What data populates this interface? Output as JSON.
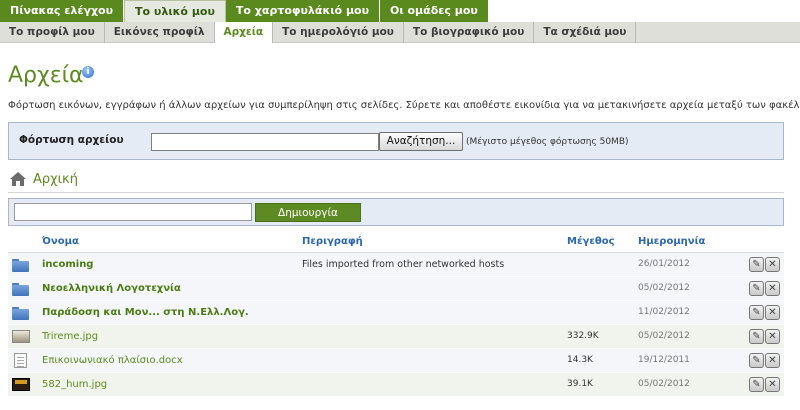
{
  "top_nav": [
    {
      "label": "Πίνακας ελέγχου",
      "active": false
    },
    {
      "label": "Το υλικό μου",
      "active": true
    },
    {
      "label": "Το χαρτοφυλάκιό μου",
      "active": false
    },
    {
      "label": "Οι ομάδες μου",
      "active": false
    }
  ],
  "sub_nav": [
    {
      "label": "Το προφίλ μου",
      "active": false
    },
    {
      "label": "Εικόνες προφίλ",
      "active": false
    },
    {
      "label": "Αρχεία",
      "active": true
    },
    {
      "label": "Το ημερολόγιό μου",
      "active": false
    },
    {
      "label": "Το βιογραφικό μου",
      "active": false
    },
    {
      "label": "Τα σχέδιά μου",
      "active": false
    }
  ],
  "page": {
    "title": "Αρχεία",
    "description": "Φόρτωση εικόνων, εγγράφων ή άλλων αρχείων για συμπερίληψη στις σελίδες. Σύρετε και αποθέστε εικονίδια για να μετακινήσετε αρχεία μεταξύ των φακέλων."
  },
  "upload": {
    "label": "Φόρτωση αρχείου",
    "input_value": "",
    "browse_label": "Αναζήτηση...",
    "max_size": "(Μέγιστο μέγεθος φόρτωσης 50MB)"
  },
  "breadcrumb": {
    "home_label": "Αρχική"
  },
  "create_folder": {
    "input_value": "",
    "button_label": "Δημιουργία φακέλου"
  },
  "table": {
    "headers": {
      "name": "Όνομα",
      "description": "Περιγραφή",
      "size": "Μέγεθος",
      "date": "Ημερομηνία"
    },
    "rows": [
      {
        "type": "folder",
        "name": "incoming",
        "description": "Files imported from other networked hosts",
        "size": "",
        "date": "26/01/2012"
      },
      {
        "type": "folder",
        "name": "Νεοελληνική Λογοτεχνία",
        "description": "",
        "size": "",
        "date": "05/02/2012"
      },
      {
        "type": "folder",
        "name": "Παράδοση και Μον... στη Ν.Ελλ.Λογ.",
        "description": "",
        "size": "",
        "date": "11/02/2012"
      },
      {
        "type": "image",
        "name": "Trireme.jpg",
        "description": "",
        "size": "332.9K",
        "date": "05/02/2012"
      },
      {
        "type": "document",
        "name": "Επικοινωνιακό πλαίσιο.docx",
        "description": "",
        "size": "14.3K",
        "date": "19/12/2011"
      },
      {
        "type": "image",
        "name": "582_hum.jpg",
        "description": "",
        "size": "39.1K",
        "date": "05/02/2012"
      }
    ]
  },
  "icons": {
    "info": "info-icon",
    "home": "home-icon",
    "folder": "folder-icon",
    "edit": "edit-icon",
    "delete": "delete-icon"
  },
  "colors": {
    "brand_green": "#5d8b1f",
    "header_blue": "#2b67b0",
    "panel_bg": "#e4ebf4"
  }
}
